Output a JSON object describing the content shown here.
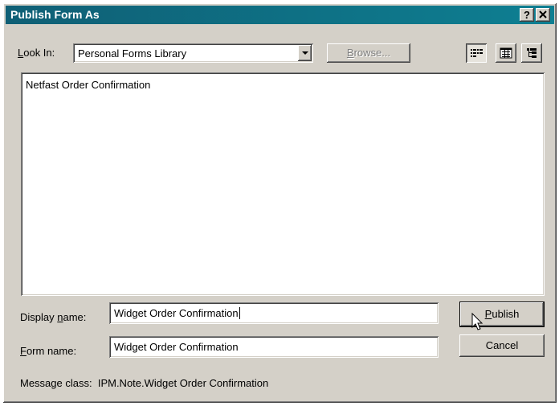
{
  "window": {
    "title": "Publish Form As",
    "help_label": "?",
    "close_label": "✕"
  },
  "look_in": {
    "label_key": "L",
    "label_rest": "ook In:",
    "selected": "Personal Forms Library"
  },
  "browse_button": {
    "label_key": "B",
    "label_rest": "rowse..."
  },
  "view_buttons": [
    "list-view-icon",
    "details-view-icon",
    "properties-view-icon"
  ],
  "forms_list": {
    "items": [
      "Netfast Order Confirmation"
    ]
  },
  "display_name": {
    "label_pre": "Display ",
    "label_key": "n",
    "label_rest": "ame:",
    "value": "Widget Order Confirmation"
  },
  "form_name": {
    "label_key": "F",
    "label_rest": "orm name:",
    "value": "Widget Order Confirmation"
  },
  "message_class": {
    "label": "Message class:",
    "value": "IPM.Note.Widget Order Confirmation"
  },
  "publish_button": {
    "label_key": "P",
    "label_rest": "ublish"
  },
  "cancel_button": {
    "label": "Cancel"
  },
  "colors": {
    "titlebar_start": "#0f5f75",
    "titlebar_end": "#0e7f92",
    "dialog_bg": "#d4d0c8"
  }
}
